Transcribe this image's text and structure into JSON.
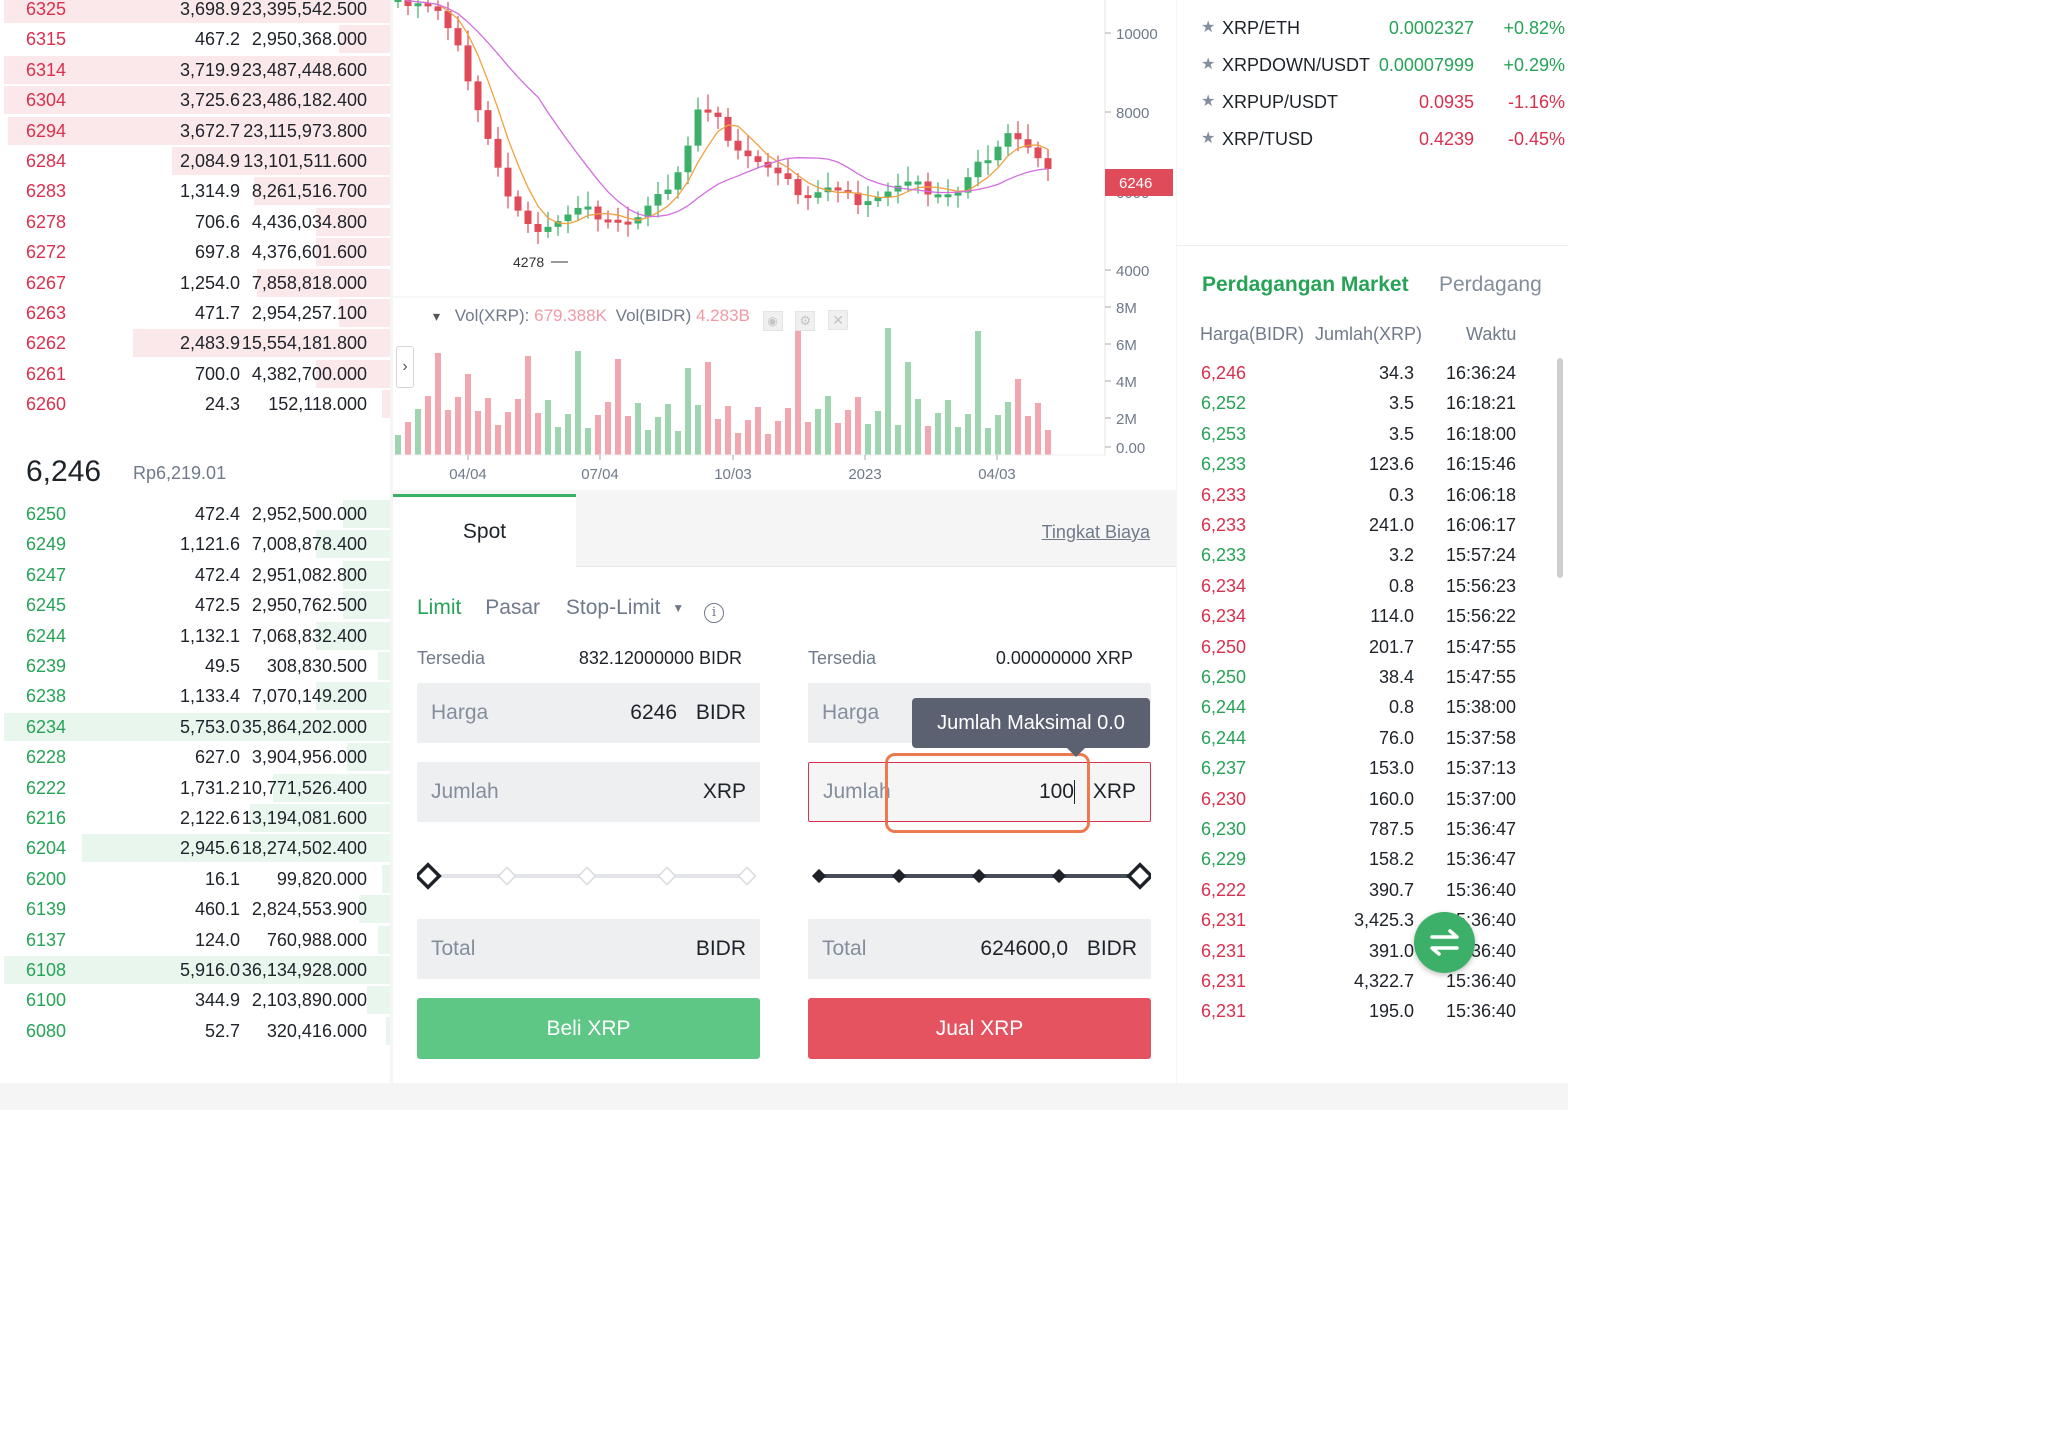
{
  "orderbook": {
    "asks": [
      {
        "price": "6325",
        "amount": "3,698.9",
        "total": "23,395,542.500",
        "depth": 0.99
      },
      {
        "price": "6315",
        "amount": "467.2",
        "total": "2,950,368.000",
        "depth": 0.13
      },
      {
        "price": "6314",
        "amount": "3,719.9",
        "total": "23,487,448.600",
        "depth": 0.99
      },
      {
        "price": "6304",
        "amount": "3,725.6",
        "total": "23,486,182.400",
        "depth": 0.99
      },
      {
        "price": "6294",
        "amount": "3,672.7",
        "total": "23,115,973.800",
        "depth": 0.98
      },
      {
        "price": "6284",
        "amount": "2,084.9",
        "total": "13,101,511.600",
        "depth": 0.56
      },
      {
        "price": "6283",
        "amount": "1,314.9",
        "total": "8,261,516.700",
        "depth": 0.35
      },
      {
        "price": "6278",
        "amount": "706.6",
        "total": "4,436,034.800",
        "depth": 0.19
      },
      {
        "price": "6272",
        "amount": "697.8",
        "total": "4,376,601.600",
        "depth": 0.19
      },
      {
        "price": "6267",
        "amount": "1,254.0",
        "total": "7,858,818.000",
        "depth": 0.34
      },
      {
        "price": "6263",
        "amount": "471.7",
        "total": "2,954,257.100",
        "depth": 0.13
      },
      {
        "price": "6262",
        "amount": "2,483.9",
        "total": "15,554,181.800",
        "depth": 0.66
      },
      {
        "price": "6261",
        "amount": "700.0",
        "total": "4,382,700.000",
        "depth": 0.19
      },
      {
        "price": "6260",
        "amount": "24.3",
        "total": "152,118.000",
        "depth": 0.02
      }
    ],
    "last_price": "6,246",
    "last_price_fiat": "Rp6,219.01",
    "bids": [
      {
        "price": "6250",
        "amount": "472.4",
        "total": "2,952,500.000",
        "depth": 0.12
      },
      {
        "price": "6249",
        "amount": "1,121.6",
        "total": "7,008,878.400",
        "depth": 0.19
      },
      {
        "price": "6247",
        "amount": "472.4",
        "total": "2,951,082.800",
        "depth": 0.12
      },
      {
        "price": "6245",
        "amount": "472.5",
        "total": "2,950,762.500",
        "depth": 0.12
      },
      {
        "price": "6244",
        "amount": "1,132.1",
        "total": "7,068,832.400",
        "depth": 0.19
      },
      {
        "price": "6239",
        "amount": "49.5",
        "total": "308,830.500",
        "depth": 0.03
      },
      {
        "price": "6238",
        "amount": "1,133.4",
        "total": "7,070,149.200",
        "depth": 0.19
      },
      {
        "price": "6234",
        "amount": "5,753.0",
        "total": "35,864,202.000",
        "depth": 0.99
      },
      {
        "price": "6228",
        "amount": "627.0",
        "total": "3,904,956.000",
        "depth": 0.11
      },
      {
        "price": "6222",
        "amount": "1,731.2",
        "total": "10,771,526.400",
        "depth": 0.3
      },
      {
        "price": "6216",
        "amount": "2,122.6",
        "total": "13,194,081.600",
        "depth": 0.36
      },
      {
        "price": "6204",
        "amount": "2,945.6",
        "total": "18,274,502.400",
        "depth": 0.79
      },
      {
        "price": "6200",
        "amount": "16.1",
        "total": "99,820.000",
        "depth": 0.02
      },
      {
        "price": "6139",
        "amount": "460.1",
        "total": "2,824,553.900",
        "depth": 0.08
      },
      {
        "price": "6137",
        "amount": "124.0",
        "total": "760,988.000",
        "depth": 0.03
      },
      {
        "price": "6108",
        "amount": "5,916.0",
        "total": "36,134,928.000",
        "depth": 0.99
      },
      {
        "price": "6100",
        "amount": "344.9",
        "total": "2,103,890.000",
        "depth": 0.06
      },
      {
        "price": "6080",
        "amount": "52.7",
        "total": "320,416.000",
        "depth": 0.01
      }
    ]
  },
  "chart": {
    "price_ticks": [
      "10000",
      "8000",
      "6000",
      "4000"
    ],
    "current_price_tag": "6246",
    "low_marker": "4278",
    "volume_ticks": [
      "8M",
      "6M",
      "4M",
      "2M",
      "0.00"
    ],
    "date_ticks": [
      "04/04",
      "07/04",
      "10/03",
      "2023",
      "04/03"
    ],
    "vol_xrp_label": "Vol(XRP):",
    "vol_xrp_value": "679.388K",
    "vol_bidr_label": "Vol(BIDR)",
    "vol_bidr_value": "4.283B",
    "expand_arrow": "›",
    "collapse_arrow": "▾",
    "colors": {
      "up": "#3cb068",
      "down": "#e04b5a",
      "ma_fast": "#f0a040",
      "ma_slow": "#d36ee0"
    }
  },
  "trade": {
    "tab_spot": "Spot",
    "fee_link": "Tingkat Biaya",
    "order_types": {
      "limit": "Limit",
      "market": "Pasar",
      "stop_limit": "Stop-Limit"
    },
    "info_icon": "i",
    "buy": {
      "available_label": "Tersedia",
      "available_value": "832.12000000 BIDR",
      "price_label": "Harga",
      "price_value": "6246",
      "price_unit": "BIDR",
      "amount_label": "Jumlah",
      "amount_value": "",
      "amount_unit": "XRP",
      "slider_percent": 0,
      "total_label": "Total",
      "total_value": "",
      "total_unit": "BIDR",
      "button": "Beli XRP"
    },
    "sell": {
      "available_label": "Tersedia",
      "available_value": "0.00000000 XRP",
      "price_label": "Harga",
      "price_unit": "BIDR",
      "amount_label": "Jumlah",
      "amount_value": "100",
      "amount_unit": "XRP",
      "slider_percent": 100,
      "total_label": "Total",
      "total_value": "624600,0",
      "total_unit": "BIDR",
      "button": "Jual XRP",
      "tooltip": "Jumlah Maksimal 0.0"
    }
  },
  "pairs": [
    {
      "name": "XRP/ETH",
      "price": "0.0002327",
      "change": "+0.82%",
      "dir": "up"
    },
    {
      "name": "XRPDOWN/USDT",
      "price": "0.00007999",
      "change": "+0.29%",
      "dir": "up"
    },
    {
      "name": "XRPUP/USDT",
      "price": "0.0935",
      "change": "-1.16%",
      "dir": "down"
    },
    {
      "name": "XRP/TUSD",
      "price": "0.4239",
      "change": "-0.45%",
      "dir": "down"
    }
  ],
  "market_trades": {
    "tab_active": "Perdagangan Market",
    "tab_other": "Perdagang",
    "col_price": "Harga(BIDR)",
    "col_amount": "Jumlah(XRP)",
    "col_time": "Waktu",
    "rows": [
      {
        "price": "6,246",
        "amount": "34.3",
        "time": "16:36:24",
        "dir": "down"
      },
      {
        "price": "6,252",
        "amount": "3.5",
        "time": "16:18:21",
        "dir": "up"
      },
      {
        "price": "6,253",
        "amount": "3.5",
        "time": "16:18:00",
        "dir": "up"
      },
      {
        "price": "6,233",
        "amount": "123.6",
        "time": "16:15:46",
        "dir": "up"
      },
      {
        "price": "6,233",
        "amount": "0.3",
        "time": "16:06:18",
        "dir": "down"
      },
      {
        "price": "6,233",
        "amount": "241.0",
        "time": "16:06:17",
        "dir": "down"
      },
      {
        "price": "6,233",
        "amount": "3.2",
        "time": "15:57:24",
        "dir": "up"
      },
      {
        "price": "6,234",
        "amount": "0.8",
        "time": "15:56:23",
        "dir": "down"
      },
      {
        "price": "6,234",
        "amount": "114.0",
        "time": "15:56:22",
        "dir": "down"
      },
      {
        "price": "6,250",
        "amount": "201.7",
        "time": "15:47:55",
        "dir": "down"
      },
      {
        "price": "6,250",
        "amount": "38.4",
        "time": "15:47:55",
        "dir": "up"
      },
      {
        "price": "6,244",
        "amount": "0.8",
        "time": "15:38:00",
        "dir": "up"
      },
      {
        "price": "6,244",
        "amount": "76.0",
        "time": "15:37:58",
        "dir": "up"
      },
      {
        "price": "6,237",
        "amount": "153.0",
        "time": "15:37:13",
        "dir": "up"
      },
      {
        "price": "6,230",
        "amount": "160.0",
        "time": "15:37:00",
        "dir": "down"
      },
      {
        "price": "6,230",
        "amount": "787.5",
        "time": "15:36:47",
        "dir": "up"
      },
      {
        "price": "6,229",
        "amount": "158.2",
        "time": "15:36:47",
        "dir": "up"
      },
      {
        "price": "6,222",
        "amount": "390.7",
        "time": "15:36:40",
        "dir": "down"
      },
      {
        "price": "6,231",
        "amount": "3,425.3",
        "time": "15:36:40",
        "dir": "down"
      },
      {
        "price": "6,231",
        "amount": "391.0",
        "time": "15:36:40",
        "dir": "down"
      },
      {
        "price": "6,231",
        "amount": "4,322.7",
        "time": "15:36:40",
        "dir": "down"
      },
      {
        "price": "6,231",
        "amount": "195.0",
        "time": "15:36:40",
        "dir": "down"
      }
    ]
  }
}
